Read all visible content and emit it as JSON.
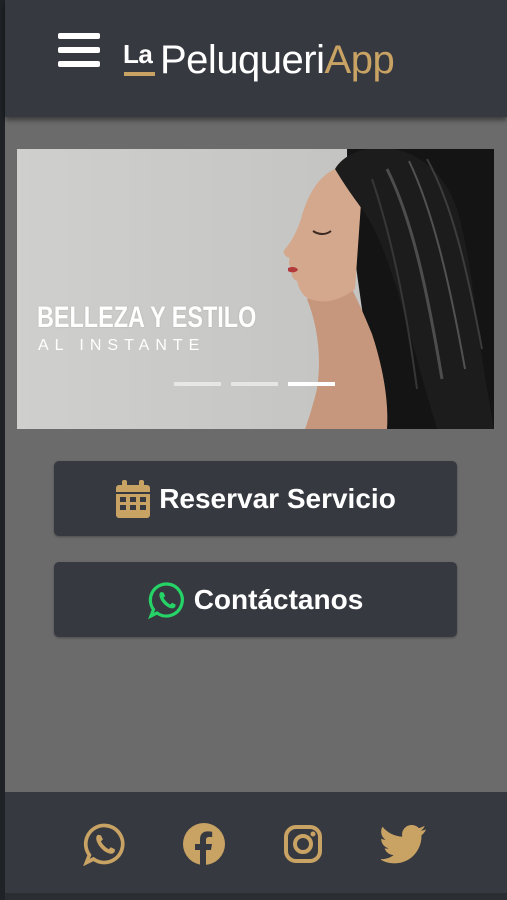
{
  "header": {
    "brand_prefix": "La",
    "brand_main": "Peluqueri",
    "brand_accent": "App",
    "accent_color": "#c9a364"
  },
  "banner": {
    "title": "BELLEZA Y ESTILO",
    "subtitle": "AL INSTANTE",
    "slides_total": 3,
    "active_slide": 3
  },
  "actions": {
    "reserve_label": "Reservar Servicio",
    "reserve_icon": "calendar-icon",
    "contact_label": "Contáctanos",
    "contact_icon": "whatsapp-icon"
  },
  "footer": {
    "social": [
      "whatsapp-icon",
      "facebook-icon",
      "instagram-icon",
      "twitter-icon"
    ]
  },
  "colors": {
    "header_bg": "#363a40",
    "page_bg": "#6b6b6b",
    "whatsapp_green": "#25d366"
  }
}
